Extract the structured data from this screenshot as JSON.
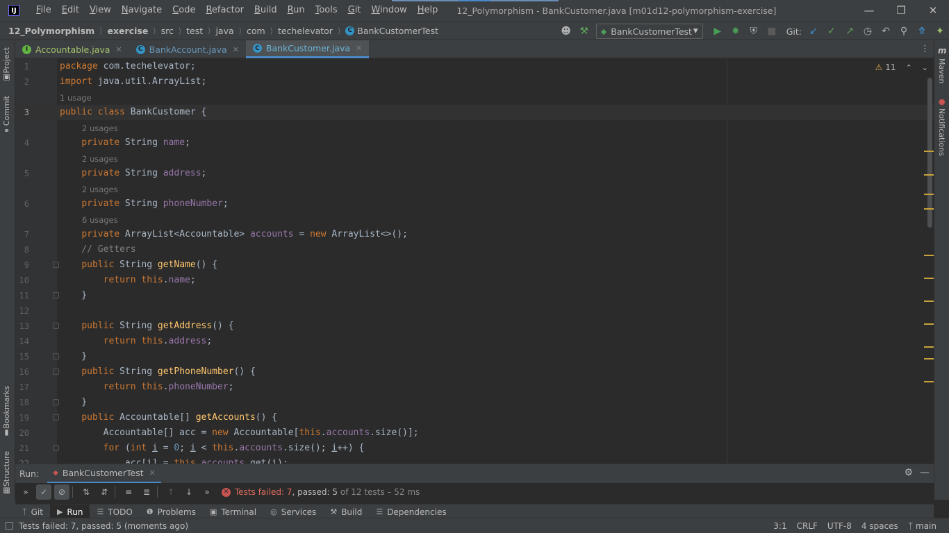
{
  "titlebar": {
    "menu": [
      "File",
      "Edit",
      "View",
      "Navigate",
      "Code",
      "Refactor",
      "Build",
      "Run",
      "Tools",
      "Git",
      "Window",
      "Help"
    ],
    "window_title": "12_Polymorphism - BankCustomer.java [m01d12-polymorphism-exercise]"
  },
  "navbar": {
    "breadcrumbs": [
      "12_Polymorphism",
      "exercise",
      "src",
      "test",
      "java",
      "com",
      "techelevator",
      "BankCustomerTest"
    ],
    "run_config": "BankCustomerTest",
    "git_label": "Git:"
  },
  "left_strip": {
    "project": "Project",
    "commit": "Commit",
    "bookmarks": "Bookmarks",
    "structure": "Structure"
  },
  "right_strip": {
    "maven": "Maven",
    "notifications": "Notifications"
  },
  "tabs": [
    {
      "label": "Accountable.java",
      "icon": "interface-icon",
      "badge": "I"
    },
    {
      "label": "BankAccount.java",
      "icon": "class-icon",
      "badge": "C"
    },
    {
      "label": "BankCustomer.java",
      "icon": "class-icon",
      "badge": "C",
      "active": true
    }
  ],
  "editor": {
    "warning_count": "11",
    "hints": {
      "one_usage": "1 usage",
      "two_usages": "2 usages",
      "six_usages": "6 usages"
    },
    "line_numbers": [
      "1",
      "2",
      "3",
      "4",
      "5",
      "6",
      "7",
      "8",
      "9",
      "10",
      "11",
      "12",
      "13",
      "14",
      "15",
      "16",
      "17",
      "18",
      "19",
      "20",
      "21",
      "22"
    ],
    "current_line": "3"
  },
  "run_panel": {
    "label": "Run:",
    "tab": "BankCustomerTest",
    "status_failed": "Tests failed: 7",
    "status_passed": "passed: 5",
    "status_rest": "of 12 tests – 52 ms"
  },
  "toolwindows": [
    "Git",
    "Run",
    "TODO",
    "Problems",
    "Terminal",
    "Services",
    "Build",
    "Dependencies"
  ],
  "statusbar": {
    "message": "Tests failed: 7, passed: 5 (moments ago)",
    "position": "3:1",
    "line_sep": "CRLF",
    "encoding": "UTF-8",
    "indent": "4 spaces",
    "branch": "main"
  },
  "colors": {
    "keyword": "#cc7832",
    "field": "#9876aa",
    "method": "#ffc66d",
    "number": "#6897bb",
    "comment": "#808080",
    "error": "#c75450",
    "accent": "#4a88c7"
  }
}
